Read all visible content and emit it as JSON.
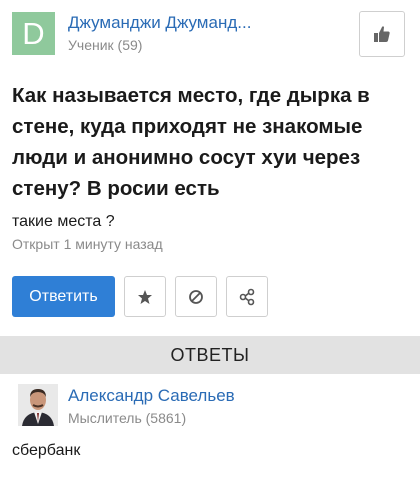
{
  "question": {
    "author": {
      "avatar_letter": "D",
      "name": "Джуманджи Джуманд...",
      "rank": "Ученик (59)"
    },
    "title": "Как называется место, где дырка в стене, куда приходят не знакомые люди и анонимно сосут хуи через стену? В росии есть",
    "extra": "такие места ?",
    "time": "Открыт 1 минуту назад"
  },
  "actions": {
    "answer_label": "Ответить",
    "icons": [
      "thumbs-up-icon",
      "star-icon",
      "report-icon",
      "share-icon"
    ]
  },
  "answers_header": "ОТВЕТЫ",
  "answer": {
    "author_name": "Александр Савельев",
    "author_rank": "Мыслитель (5861)",
    "text": "сбербанк"
  },
  "colors": {
    "link": "#2a6bb5",
    "primary_button": "#2f7fd6",
    "avatar_bg": "#8fc99c",
    "answers_bar": "#e2e2e2",
    "muted_text": "#8a8a8a"
  }
}
